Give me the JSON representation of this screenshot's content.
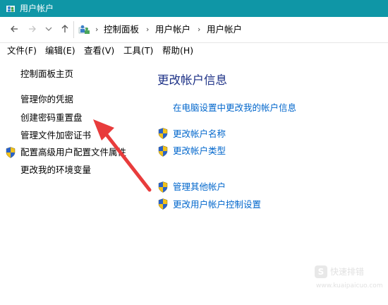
{
  "window": {
    "title": "用户帐户",
    "accent_color": "#0f96a6"
  },
  "nav": {
    "back_icon": "arrow-left",
    "forward_icon": "arrow-right",
    "recent_icon": "chevron-down",
    "up_icon": "arrow-up",
    "breadcrumbs": [
      "控制面板",
      "用户帐户",
      "用户帐户"
    ]
  },
  "menubar": {
    "items": [
      "文件(F)",
      "编辑(E)",
      "查看(V)",
      "工具(T)",
      "帮助(H)"
    ]
  },
  "sidebar": {
    "home_link": "控制面板主页",
    "links": [
      "管理你的凭据",
      "创建密码重置盘",
      "管理文件加密证书",
      "配置高级用户配置文件属性",
      "更改我的环境变量"
    ]
  },
  "main": {
    "title": "更改帐户信息",
    "pc_settings_link": "在电脑设置中更改我的帐户信息",
    "links_group1": [
      "更改帐户名称",
      "更改帐户类型"
    ],
    "links_group2": [
      "管理其他帐户",
      "更改用户帐户控制设置"
    ],
    "link_color": "#0066cc",
    "title_color": "#1e3287"
  },
  "annotation": {
    "arrow_color": "#e83c3c"
  },
  "watermark": {
    "badge": "S",
    "text": "快速排错",
    "url": "www.kuaipaicuo.com"
  }
}
